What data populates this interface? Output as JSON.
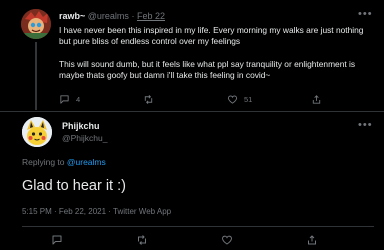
{
  "parent_tweet": {
    "name": "rawb~",
    "handle": "@urealms",
    "separator": "·",
    "date": "Feb 22",
    "more_icon": "more-horizontal-icon",
    "paragraphs": [
      "I have never been this inspired in my life. Every morning my walks are just nothing but pure bliss of endless control over my feelings",
      "This will sound dumb, but it feels like what ppl say tranquility or enlightenment is maybe thats goofy but damn i'll take this feeling in covid~"
    ],
    "actions": {
      "reply_count": "4",
      "retweet_count": "",
      "like_count": "51",
      "share_count": ""
    }
  },
  "reply_tweet": {
    "name": "Phijkchu",
    "handle": "@Phijkchu_",
    "replying_to_prefix": "Replying to ",
    "replying_to_handle": "@urealms",
    "text": "Glad to hear it :)",
    "meta": "5:15 PM · Feb 22, 2021 · Twitter Web App"
  },
  "colors": {
    "background": "#000000",
    "primary_text": "#e7e9ea",
    "secondary_text": "#71767b",
    "accent": "#1d9bf0",
    "divider": "#2f3336"
  }
}
